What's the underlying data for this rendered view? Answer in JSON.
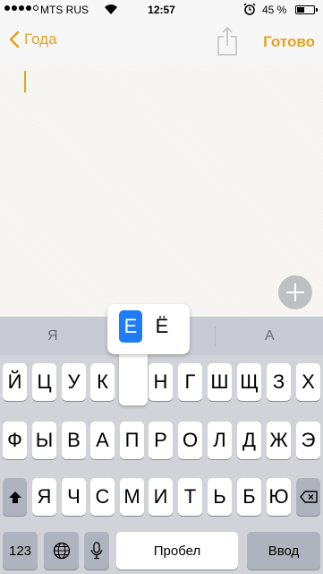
{
  "status": {
    "carrier": "MTS RUS",
    "time": "12:57",
    "battery": "45 %"
  },
  "nav": {
    "back_label": "Года",
    "done_label": "Готово"
  },
  "suggestions": [
    "Я",
    "А"
  ],
  "accent_popup": {
    "options": [
      "Е",
      "Ё"
    ],
    "selected": "Е"
  },
  "keyboard": {
    "row1": [
      "Й",
      "Ц",
      "У",
      "К",
      "Е",
      "Н",
      "Г",
      "Ш",
      "Щ",
      "З",
      "Х"
    ],
    "row2": [
      "Ф",
      "Ы",
      "В",
      "А",
      "П",
      "Р",
      "О",
      "Л",
      "Д",
      "Ж",
      "Э"
    ],
    "row3": [
      "Я",
      "Ч",
      "С",
      "М",
      "И",
      "Т",
      "Ь",
      "Б",
      "Ю"
    ],
    "numbers_label": "123",
    "space_label": "Пробел",
    "enter_label": "Ввод"
  },
  "colors": {
    "accent": "#e4a31e",
    "selection": "#1f7cf5",
    "keyboard_bg": "#d1d3d9"
  },
  "icons": {
    "back": "chevron-left-icon",
    "share": "share-icon",
    "add": "plus-icon",
    "shift": "shift-icon",
    "delete": "backspace-icon",
    "globe": "globe-icon",
    "mic": "microphone-icon"
  }
}
